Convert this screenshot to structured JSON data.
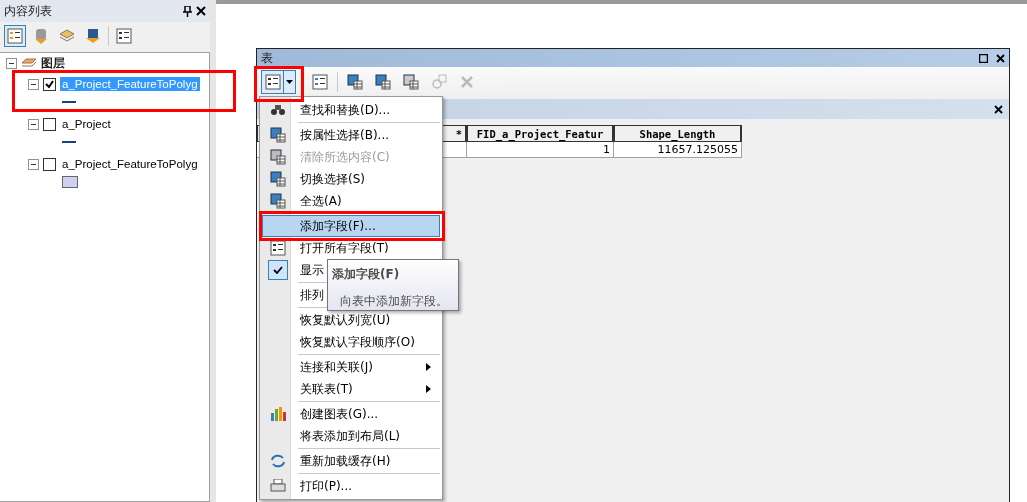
{
  "contents_panel": {
    "title": "内容列表",
    "tree": [
      {
        "label": "图层",
        "expanded": true,
        "children": [
          {
            "label": "a_Project_FeatureToPolyg",
            "expanded": true,
            "checked": true,
            "selected": true,
            "kind": "line"
          },
          {
            "label": "a_Project",
            "expanded": true,
            "checked": false,
            "selected": false,
            "kind": "line"
          },
          {
            "label": "a_Project_FeatureToPolyg",
            "expanded": true,
            "checked": false,
            "selected": false,
            "kind": "fill"
          }
        ]
      }
    ]
  },
  "table_window": {
    "title": "表",
    "columns": [
      "*",
      "FID_a_Project_Featur",
      "Shape_Length"
    ],
    "rows": [
      [
        "",
        "1",
        "11657.125055"
      ]
    ],
    "menu": [
      {
        "kind": "item",
        "label": "查找和替换(D)...",
        "disabled": false,
        "checked": false,
        "selected": false,
        "submenu": false
      },
      {
        "kind": "separator"
      },
      {
        "kind": "item",
        "label": "按属性选择(B)...",
        "disabled": false,
        "checked": false,
        "selected": false,
        "submenu": false
      },
      {
        "kind": "item",
        "label": "清除所选内容(C)",
        "disabled": true,
        "checked": false,
        "selected": false,
        "submenu": false
      },
      {
        "kind": "item",
        "label": "切换选择(S)",
        "disabled": false,
        "checked": false,
        "selected": false,
        "submenu": false
      },
      {
        "kind": "item",
        "label": "全选(A)",
        "disabled": false,
        "checked": false,
        "selected": false,
        "submenu": false
      },
      {
        "kind": "separator"
      },
      {
        "kind": "item",
        "label": "添加字段(F)...",
        "disabled": false,
        "checked": false,
        "selected": true,
        "submenu": false
      },
      {
        "kind": "item",
        "label": "打开所有字段(T)",
        "disabled": false,
        "checked": false,
        "selected": false,
        "submenu": false
      },
      {
        "kind": "item",
        "label": "显示",
        "disabled": false,
        "checked": true,
        "selected": false
      },
      {
        "kind": "separator"
      },
      {
        "kind": "item",
        "label": "排列",
        "disabled": false,
        "checked": false,
        "selected": false
      },
      {
        "kind": "separator"
      },
      {
        "kind": "item",
        "label": "恢复默认列宽(U)",
        "disabled": false,
        "checked": false,
        "selected": false,
        "submenu": false
      },
      {
        "kind": "item",
        "label": "恢复默认字段顺序(O)",
        "disabled": false,
        "checked": false,
        "selected": false,
        "submenu": false
      },
      {
        "kind": "separator"
      },
      {
        "kind": "item",
        "label": "连接和关联(J)",
        "disabled": false,
        "checked": false,
        "selected": false,
        "submenu": true
      },
      {
        "kind": "item",
        "label": "关联表(T)",
        "disabled": false,
        "checked": false,
        "selected": false,
        "submenu": true
      },
      {
        "kind": "separator"
      },
      {
        "kind": "item",
        "label": "创建图表(G)...",
        "disabled": false,
        "checked": false,
        "selected": false,
        "submenu": false
      },
      {
        "kind": "item",
        "label": "将表添加到布局(L)",
        "disabled": false,
        "checked": false,
        "selected": false,
        "submenu": false
      },
      {
        "kind": "separator"
      },
      {
        "kind": "item",
        "label": "重新加载缓存(H)",
        "disabled": false,
        "checked": false,
        "selected": false,
        "submenu": false
      },
      {
        "kind": "separator"
      },
      {
        "kind": "item",
        "label": "打印(P)...",
        "disabled": false,
        "checked": false,
        "selected": false,
        "submenu": false
      }
    ],
    "tooltip": {
      "title": "添加字段(F)",
      "text": "向表中添加新字段。"
    }
  }
}
